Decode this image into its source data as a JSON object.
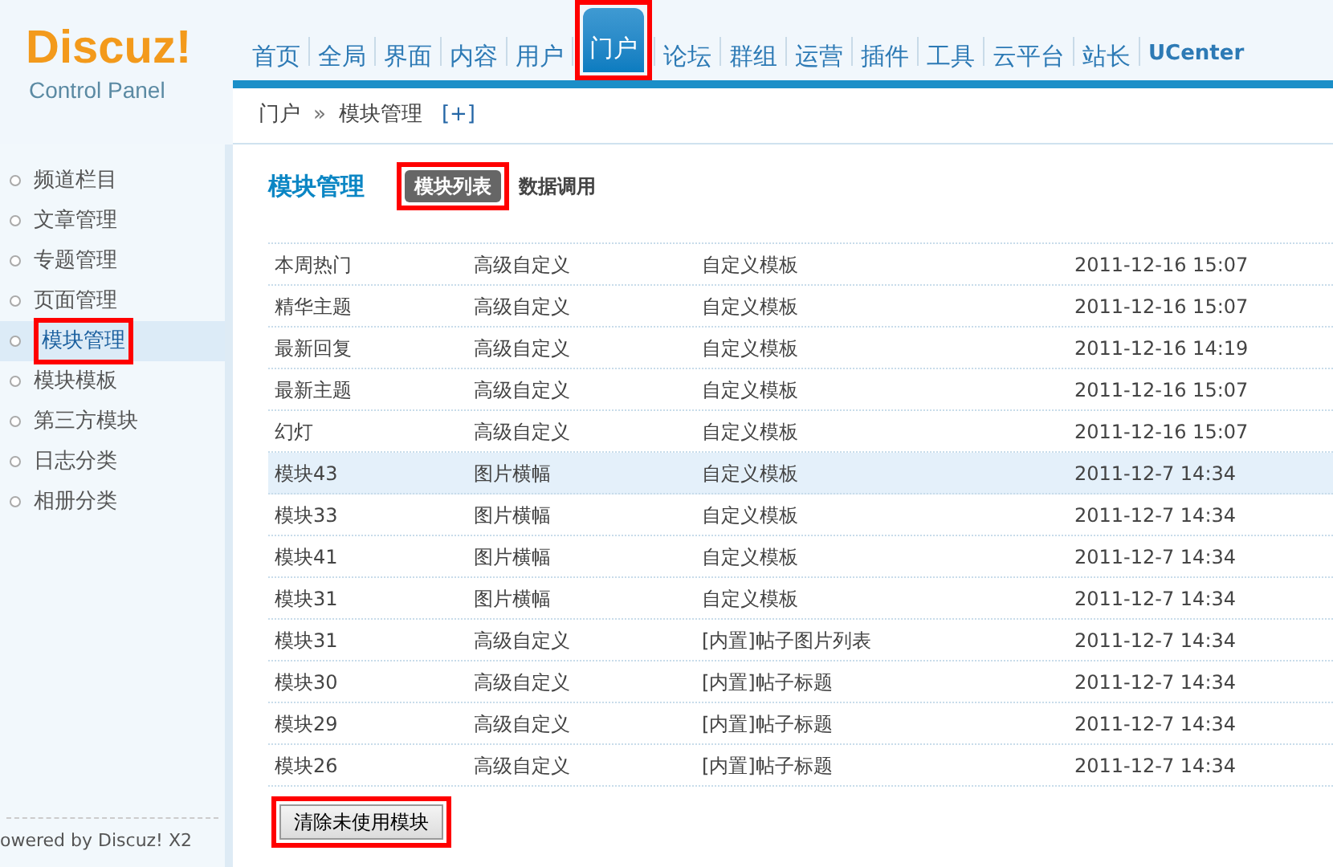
{
  "logo": {
    "name": "Discuz!",
    "subtitle": "Control Panel"
  },
  "nav": [
    {
      "label": "首页",
      "selected": false,
      "highlighted": false
    },
    {
      "label": "全局",
      "selected": false,
      "highlighted": false
    },
    {
      "label": "界面",
      "selected": false,
      "highlighted": false
    },
    {
      "label": "内容",
      "selected": false,
      "highlighted": false
    },
    {
      "label": "用户",
      "selected": false,
      "highlighted": false
    },
    {
      "label": "门户",
      "selected": true,
      "highlighted": true
    },
    {
      "label": "论坛",
      "selected": false,
      "highlighted": false
    },
    {
      "label": "群组",
      "selected": false,
      "highlighted": false
    },
    {
      "label": "运营",
      "selected": false,
      "highlighted": false
    },
    {
      "label": "插件",
      "selected": false,
      "highlighted": false
    },
    {
      "label": "工具",
      "selected": false,
      "highlighted": false
    },
    {
      "label": "云平台",
      "selected": false,
      "highlighted": false
    },
    {
      "label": "站长",
      "selected": false,
      "highlighted": false
    },
    {
      "label": "UCenter",
      "selected": false,
      "highlighted": false
    }
  ],
  "breadcrumb": {
    "items": [
      "门户",
      "模块管理"
    ],
    "separator": "»",
    "add": "[+]"
  },
  "sidebar": {
    "items": [
      {
        "label": "频道栏目",
        "selected": false,
        "highlighted": false
      },
      {
        "label": "文章管理",
        "selected": false,
        "highlighted": false
      },
      {
        "label": "专题管理",
        "selected": false,
        "highlighted": false
      },
      {
        "label": "页面管理",
        "selected": false,
        "highlighted": false
      },
      {
        "label": "模块管理",
        "selected": true,
        "highlighted": true
      },
      {
        "label": "模块模板",
        "selected": false,
        "highlighted": false
      },
      {
        "label": "第三方模块",
        "selected": false,
        "highlighted": false
      },
      {
        "label": "日志分类",
        "selected": false,
        "highlighted": false
      },
      {
        "label": "相册分类",
        "selected": false,
        "highlighted": false
      }
    ],
    "footer": "owered by Discuz! X2"
  },
  "page_title": "模块管理",
  "subtabs": [
    {
      "label": "模块列表",
      "selected": true,
      "highlighted": true
    },
    {
      "label": "数据调用",
      "selected": false,
      "highlighted": false
    }
  ],
  "table": {
    "rows": [
      {
        "cells": [
          "本周热门",
          "高级自定义",
          "自定义模板",
          "2011-12-16 15:07"
        ],
        "hover": false
      },
      {
        "cells": [
          "精华主题",
          "高级自定义",
          "自定义模板",
          "2011-12-16 15:07"
        ],
        "hover": false
      },
      {
        "cells": [
          "最新回复",
          "高级自定义",
          "自定义模板",
          "2011-12-16 14:19"
        ],
        "hover": false
      },
      {
        "cells": [
          "最新主题",
          "高级自定义",
          "自定义模板",
          "2011-12-16 15:07"
        ],
        "hover": false
      },
      {
        "cells": [
          "幻灯",
          "高级自定义",
          "自定义模板",
          "2011-12-16 15:07"
        ],
        "hover": false
      },
      {
        "cells": [
          "模块43",
          "图片横幅",
          "自定义模板",
          "2011-12-7 14:34"
        ],
        "hover": true
      },
      {
        "cells": [
          "模块33",
          "图片横幅",
          "自定义模板",
          "2011-12-7 14:34"
        ],
        "hover": false
      },
      {
        "cells": [
          "模块41",
          "图片横幅",
          "自定义模板",
          "2011-12-7 14:34"
        ],
        "hover": false
      },
      {
        "cells": [
          "模块31",
          "图片横幅",
          "自定义模板",
          "2011-12-7 14:34"
        ],
        "hover": false
      },
      {
        "cells": [
          "模块31",
          "高级自定义",
          "[内置]帖子图片列表",
          "2011-12-7 14:34"
        ],
        "hover": false
      },
      {
        "cells": [
          "模块30",
          "高级自定义",
          "[内置]帖子标题",
          "2011-12-7 14:34"
        ],
        "hover": false
      },
      {
        "cells": [
          "模块29",
          "高级自定义",
          "[内置]帖子标题",
          "2011-12-7 14:34"
        ],
        "hover": false
      },
      {
        "cells": [
          "模块26",
          "高级自定义",
          "[内置]帖子标题",
          "2011-12-7 14:34"
        ],
        "hover": false
      }
    ]
  },
  "button": {
    "label": "清除未使用模块",
    "highlighted": true
  }
}
